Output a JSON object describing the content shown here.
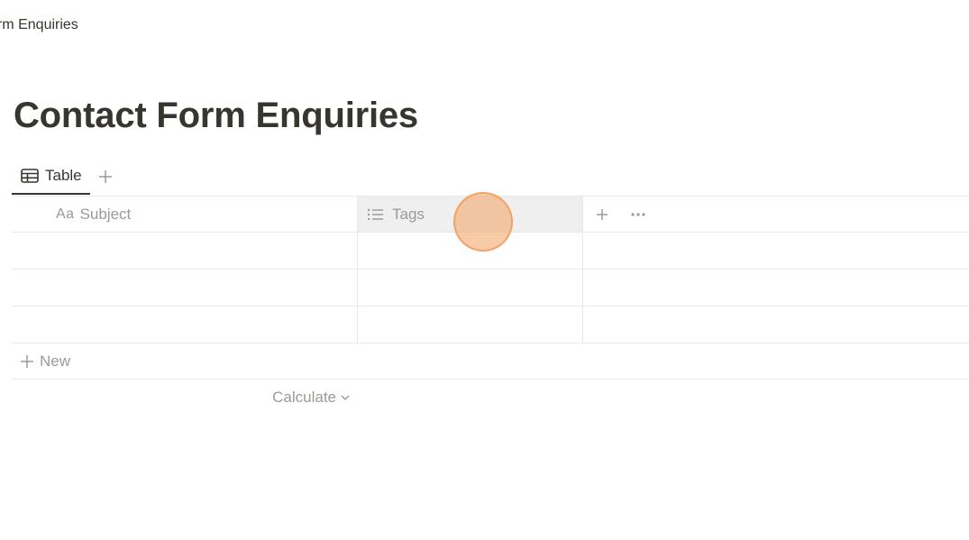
{
  "breadcrumb": "rm Enquiries",
  "page_title": "Contact Form Enquiries",
  "views": {
    "tabs": [
      {
        "label": "Table",
        "icon": "table-icon"
      }
    ],
    "add_view_icon": "plus-icon"
  },
  "table": {
    "columns": [
      {
        "label": "Subject",
        "icon": "Aa"
      },
      {
        "label": "Tags",
        "icon": "list-icon"
      }
    ],
    "rows": [
      {
        "subject": "",
        "tags": ""
      },
      {
        "subject": "",
        "tags": ""
      },
      {
        "subject": "",
        "tags": ""
      }
    ],
    "add_column_icon": "plus-icon",
    "more_icon": "ellipsis-icon",
    "new_label": "New",
    "calculate_label": "Calculate"
  },
  "colors": {
    "text": "#37352f",
    "muted": "#9b9a97",
    "border": "#e9e9e7",
    "header_highlight": "#efefef",
    "click_marker": "#f4a86e"
  }
}
